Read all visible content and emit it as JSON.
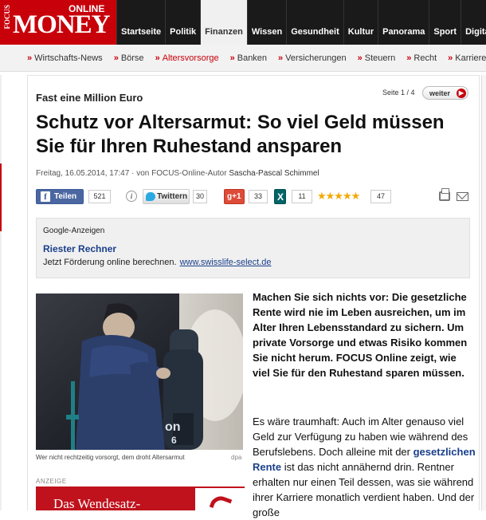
{
  "brand": {
    "focus": "FOCUS",
    "money": "MONEY",
    "online": "ONLINE"
  },
  "main_nav": [
    {
      "label": "Startseite",
      "active": false
    },
    {
      "label": "Politik",
      "active": false
    },
    {
      "label": "Finanzen",
      "active": true
    },
    {
      "label": "Wissen",
      "active": false
    },
    {
      "label": "Gesundheit",
      "active": false
    },
    {
      "label": "Kultur",
      "active": false
    },
    {
      "label": "Panorama",
      "active": false
    },
    {
      "label": "Sport",
      "active": false
    },
    {
      "label": "Digital",
      "active": false
    }
  ],
  "sub_nav": [
    {
      "label": "Wirtschafts-News",
      "active": false
    },
    {
      "label": "Börse",
      "active": false
    },
    {
      "label": "Altersvorsorge",
      "active": true
    },
    {
      "label": "Banken",
      "active": false
    },
    {
      "label": "Versicherungen",
      "active": false
    },
    {
      "label": "Steuern",
      "active": false
    },
    {
      "label": "Recht",
      "active": false
    },
    {
      "label": "Karriere",
      "active": false
    }
  ],
  "article": {
    "kicker": "Fast eine Million Euro",
    "pager": "Seite 1 / 4",
    "next_label": "weiter",
    "headline": "Schutz vor Altersarmut: So viel Geld müssen Sie für Ihren Ruhestand ansparen",
    "byline_prefix": "Freitag, 16.05.2014, 17:47 · von FOCUS-Online-Autor ",
    "author": "Sascha-Pascal Schimmel",
    "lead": "Machen Sie sich nichts vor: Die gesetzliche Rente wird nie im Leben ausreichen, um im Alter Ihren Lebensstandard zu sichern. Um private Vorsorge und etwas Risiko kommen Sie nicht herum. FOCUS Online zeigt, wie viel Sie für den Ruhestand sparen müssen.",
    "body_1": "Es wäre traumhaft: Auch im Alter genauso viel Geld zur Verfügung zu haben wie während des Berufslebens. Doch alleine mit der ",
    "body_link": "gesetzlichen Rente",
    "body_2": " ist das nicht annähernd drin. Rentner erhalten nur einen Teil dessen, was sie während ihrer Karriere monatlich verdient haben. Und der große",
    "photo_caption": "Wer nicht rechtzeitig vorsorgt, dem droht Altersarmut",
    "photo_credit": "dpa"
  },
  "share": {
    "facebook_label": "Teilen",
    "facebook_count": "521",
    "info_glyph": "i",
    "twitter_label": "Twittern",
    "twitter_count": "30",
    "gplus_label": "g+1",
    "gplus_count": "33",
    "xing_glyph": "X",
    "xing_count": "11",
    "stars": "★★★★★",
    "rating_count": "47",
    "star_color": "#f2a900"
  },
  "ads": {
    "label": "Google-Anzeigen",
    "title": "Riester Rechner",
    "text": "Jetzt Förderung online berechnen.",
    "url": "www.swisslife-select.de"
  },
  "promo": {
    "label": "ANZEIGE",
    "text": "Das Wendesatz-"
  },
  "colors": {
    "brand_red": "#c8000a",
    "link_blue": "#1a3f8b",
    "nav_dark": "#1a1a1a"
  }
}
